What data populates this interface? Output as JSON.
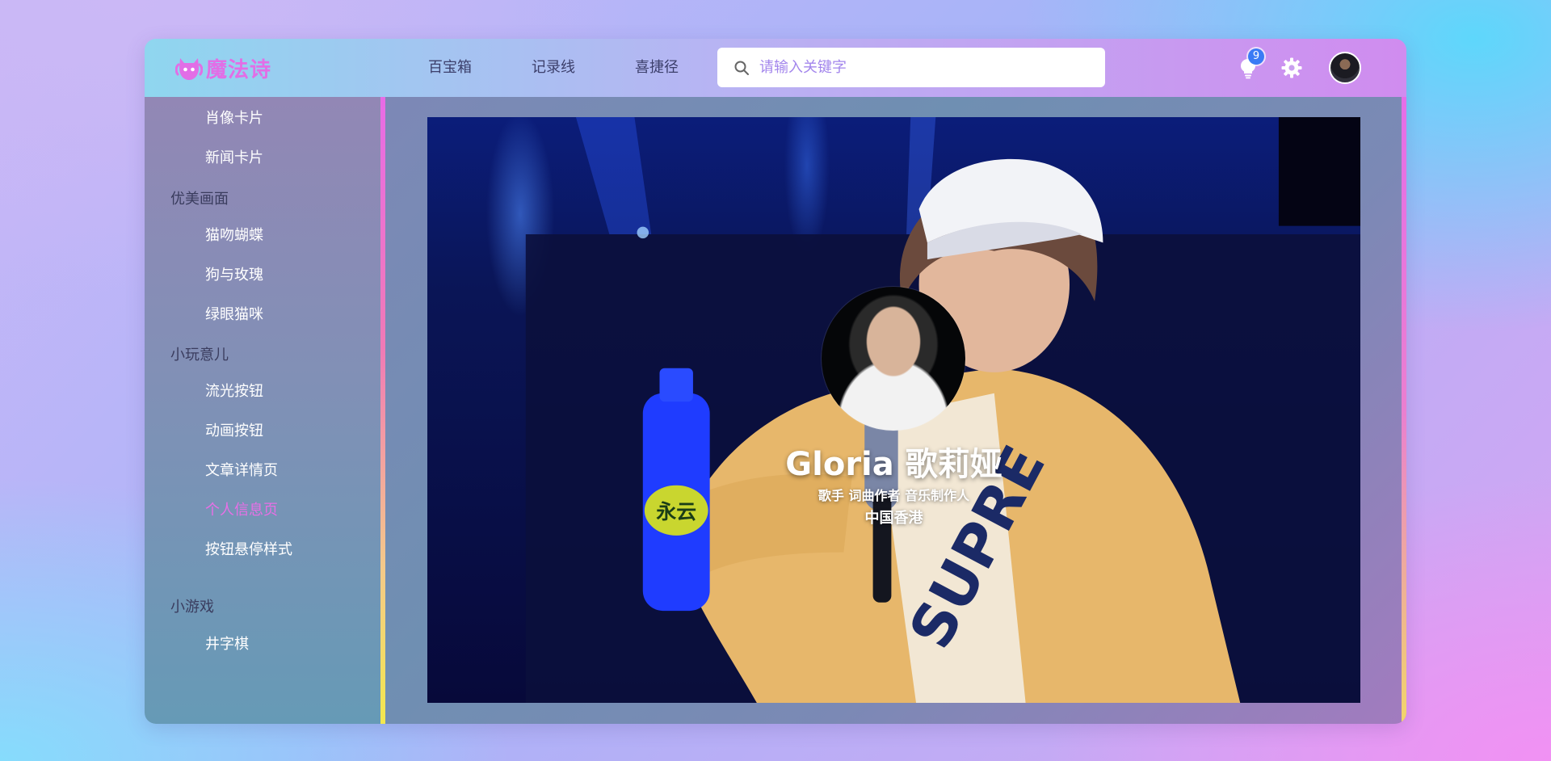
{
  "app": {
    "logo_text": "魔法诗"
  },
  "header": {
    "nav": [
      "百宝箱",
      "记录线",
      "喜捷径"
    ],
    "search": {
      "placeholder": "请输入关键字",
      "value": ""
    },
    "notification_count": "9",
    "icons": [
      "lightbulb-icon",
      "gear-icon",
      "avatar"
    ]
  },
  "sidebar": {
    "items": [
      {
        "type": "item",
        "label": "肖像卡片"
      },
      {
        "type": "item",
        "label": "新闻卡片"
      },
      {
        "type": "group",
        "label": "优美画面"
      },
      {
        "type": "item",
        "label": "猫吻蝴蝶"
      },
      {
        "type": "item",
        "label": "狗与玫瑰"
      },
      {
        "type": "item",
        "label": "绿眼猫咪"
      },
      {
        "type": "group",
        "label": "小玩意儿"
      },
      {
        "type": "item",
        "label": "流光按钮"
      },
      {
        "type": "item",
        "label": "动画按钮"
      },
      {
        "type": "item",
        "label": "文章详情页"
      },
      {
        "type": "item",
        "label": "个人信息页",
        "active": true
      },
      {
        "type": "item",
        "label": "按钮悬停样式"
      },
      {
        "type": "group",
        "label": "小游戏"
      },
      {
        "type": "item",
        "label": "井字棋"
      }
    ]
  },
  "profile": {
    "name": "Gloria 歌莉娅",
    "roles": "歌手 词曲作者 音乐制作人",
    "location": "中国香港"
  },
  "colors": {
    "accent": "#e26ee6",
    "active_menu": "#e86fe6",
    "badge": "#3a7bf5"
  }
}
